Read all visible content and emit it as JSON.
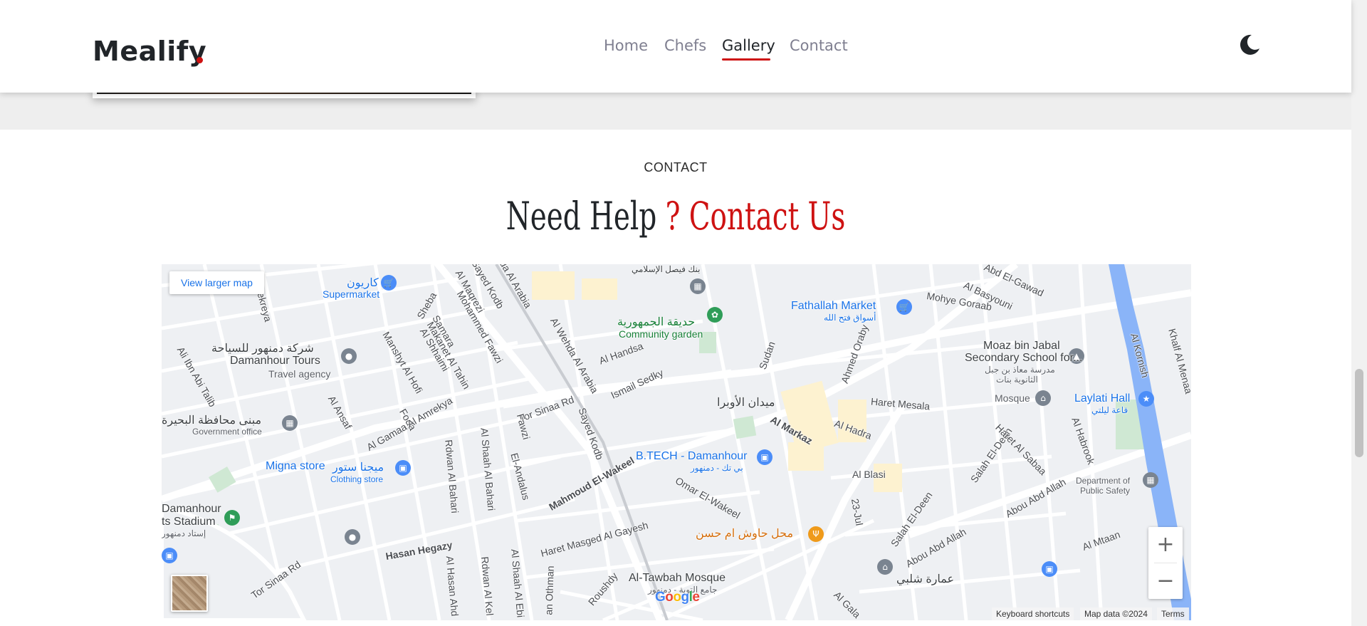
{
  "header": {
    "logo": "Mealify",
    "nav": [
      {
        "label": "Home"
      },
      {
        "label": "Chefs"
      },
      {
        "label": "Gallery"
      },
      {
        "label": "Contact"
      }
    ],
    "active_nav": "Gallery"
  },
  "contact": {
    "eyebrow": "CONTACT",
    "title_dark": "Need Help",
    "title_accent": "? Contact Us"
  },
  "map": {
    "view_larger": "View larger map",
    "zoom_in": "+",
    "zoom_out": "−",
    "google": "Google",
    "keyboard_shortcuts": "Keyboard shortcuts",
    "map_data": "Map data ©2024",
    "terms": "Terms",
    "places": {
      "caryon_ar": "كاريون",
      "supermarket": "Supermarket",
      "faisal_bank_ar": "بنك فيصل الإسلامي",
      "republic_garden_ar": "حديقة الجمهورية",
      "community_garden": "Community garden",
      "fathallah": "Fathallah Market",
      "fathallah_ar": "أسواق فتح الله",
      "damanhour_tours_ar": "شركة دمنهور للسياحة",
      "damanhour_tours": "Damanhour Tours",
      "travel_agency": "Travel agency",
      "moaz_1": "Moaz bin Jabal",
      "moaz_2": "Secondary School for...",
      "moaz_ar_1": "مدرسة معاذ بن جبل",
      "moaz_ar_2": "الثانوية بنات",
      "mosque": "Mosque",
      "laylati": "Laylati Hall",
      "laylati_ar": "قاعة ليلتي",
      "midan_opera_ar": "ميدان الأوبرا",
      "gov_building_ar": "مبنى محافظة البحيرة",
      "gov_office": "Government office",
      "btech": "B.TECH - Damanhour",
      "btech_ar": "بي تك - دمنهور",
      "migna": "Migna store",
      "migna_ar": "ميجنا ستور",
      "clothing": "Clothing store",
      "stadium_1": "Damanhour",
      "stadium_2": "ts Stadium",
      "stadium_ar": "إستاد دمنهور",
      "dept_1": "Department of",
      "dept_2": "Public Safety",
      "hawash_ar": "محل حاوش ام حسن",
      "tawbah": "Al-Tawbah Mosque",
      "tawbah_ar": "جامع التوبة - دمنهور",
      "shalaby_ar": "عمارة شلبي"
    },
    "streets": {
      "sheba": "Sheba",
      "sayed_kodb": "Sayed Kodb",
      "sayed_kodb2": "Sayed Kodb",
      "al_maqrezi": "Al Maqrezi",
      "mohammed_fawzi": "Mohammed Fawzi",
      "samara": "Samara",
      "makanet": "Makanet Al Tahin",
      "al_shhaimi": "Al Shhaimi",
      "manshyt": "Manshyt Al Hofi",
      "al_ansaf": "Al Ansaf",
      "foda": "Foda",
      "al_gamaa": "Al Gamaa Al Amrekya",
      "al_wehda": "Al Wehda Al Arabia",
      "al_wehda2": "da Al Arabia",
      "al_handsa": "Al Handsa",
      "ismail_sedky": "Ismail Sedky",
      "tor_sinaa": "Tor Sinaa Rd",
      "tor_sinaa2": "Tor Sinaa Rd",
      "sudan": "Sudan",
      "ahmed_oraby": "Ahmed Oraby",
      "al_markaz": "Al Markaz",
      "al_hadra": "Al Hadra",
      "haret_mesala": "Haret Mesala",
      "abd_el_gawad": "Abd El-Gawad",
      "al_basyouni": "Al Basyouni",
      "mohye_goraab": "Mohye Goraab",
      "al_kornish": "Al Kornish",
      "khalf_al_menaa": "Khalf Al Menaa",
      "salah_el_deen": "Salah El-Deen",
      "haret_al_sabaa": "Haret Al Sabaa",
      "al_habrook": "Al Habrook",
      "al_blasi": "Al Blasi",
      "jul_23": "23-Jul",
      "omar_el_wakeel": "Omar El-Wakeel",
      "mahmoud_el_wakeel": "Mahmoud El-Wakeel",
      "fawzi": "Fawzi",
      "el_andalus": "El-Andalus",
      "al_shaah_al_bahari": "Al Shaah Al Bahari",
      "rdwan_al_bahari": "Rdwan Al Bahari",
      "hasan_hegazy": "Hasan Hegazy",
      "haret_masged": "Haret Masged Al Gayesh",
      "roushdy": "Roushdy",
      "al_hassan_ahd": "Al Hasan Ahd",
      "rdwan_al_kel": "Rdwan Al Kel",
      "al_shaah_al_ebi": "Al Shaah Al Ebi",
      "othman": "an Othman",
      "abou_abd_allah": "Abou Abd Allah",
      "abou_abd_allah2": "Abou Abd Allah",
      "salah_el_deen2": "Salah El-Deen",
      "al_mtaan": "Al Mtaan",
      "al_galal": "Al Gala",
      "al_fekreya": "Al Fekreya",
      "ali_ibn_abi_talib": "Ali Ibn Abi Talib"
    }
  },
  "colors": {
    "accent": "#ce1212",
    "text_dark": "#212529",
    "nav_inactive": "#7f7f90",
    "map_link": "#1a73e8"
  }
}
